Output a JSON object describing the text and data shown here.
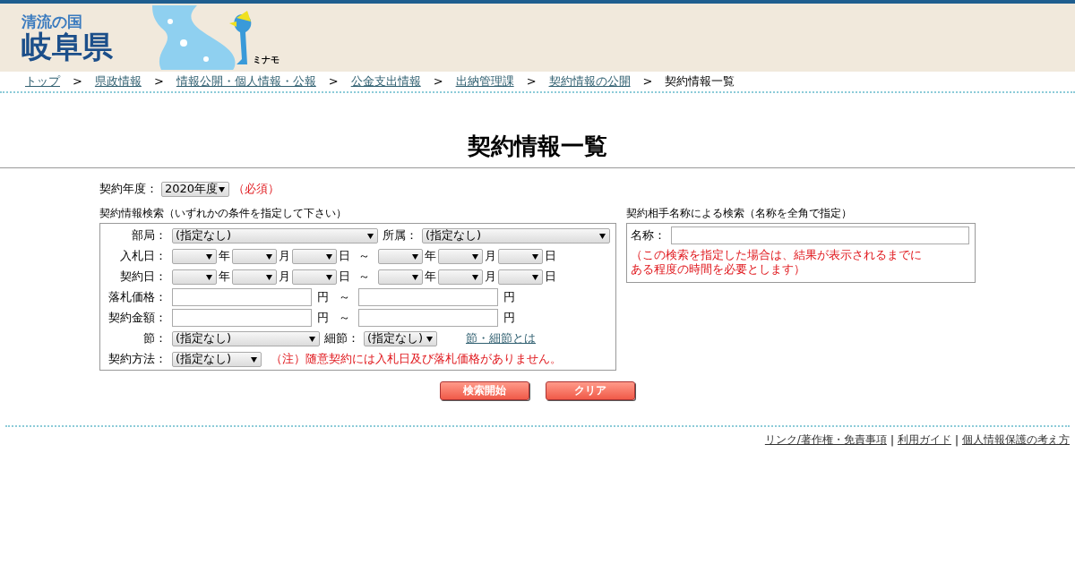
{
  "header": {
    "logo_top": "清流の国",
    "logo_main": "岐阜県",
    "mascot_label": "ミナモ"
  },
  "breadcrumb": [
    {
      "label": "トップ",
      "link": true,
      "sep": ">"
    },
    {
      "label": "県政情報",
      "link": true,
      "sep": ">"
    },
    {
      "label": "情報公開・個人情報・公報",
      "link": true,
      "sep": ">"
    },
    {
      "label": "公金支出情報",
      "link": true,
      "sep": ">"
    },
    {
      "label": "出納管理課",
      "link": true,
      "sep": ">"
    },
    {
      "label": "契約情報の公開",
      "link": true,
      "sep": ">"
    },
    {
      "label": "契約情報一覧",
      "link": false
    }
  ],
  "title": "契約情報一覧",
  "year": {
    "label": "契約年度：",
    "value": "2020年度",
    "required": "（必須）"
  },
  "criteria": {
    "legend": "契約情報検索（いずれかの条件を指定して下さい）",
    "rows": [
      {
        "kind": "pair",
        "label": "部局：",
        "value": "(指定なし)",
        "label2": "所属：",
        "value2": "(指定なし)"
      },
      {
        "kind": "date",
        "label": "入札日：",
        "units": [
          "年",
          "月",
          "日"
        ],
        "tilde": "～",
        "units2": [
          "年",
          "月",
          "日"
        ]
      },
      {
        "kind": "date",
        "label": "契約日：",
        "units": [
          "年",
          "月",
          "日"
        ],
        "tilde": "～",
        "units2": [
          "年",
          "月",
          "日"
        ]
      },
      {
        "kind": "amount",
        "label": "落札価格：",
        "unit": "円",
        "tilde": "～",
        "unit2": "円"
      },
      {
        "kind": "amount",
        "label": "契約金額：",
        "unit": "円",
        "tilde": "～",
        "unit2": "円"
      },
      {
        "kind": "section",
        "label": "節：",
        "value": "(指定なし)",
        "label2": "細節：",
        "value2": "(指定なし)",
        "link": "節・細節とは"
      },
      {
        "kind": "method",
        "label": "契約方法：",
        "value": "(指定なし)",
        "note": "（注）随意契約には入札日及び落札価格がありません。"
      }
    ]
  },
  "name_search": {
    "legend": "契約相手名称による検索（名称を全角で指定）",
    "label": "名称：",
    "note_lines": [
      "（この検索を指定した場合は、結果が表示されるまでに",
      "ある程度の時間を必要とします）"
    ]
  },
  "buttons": [
    "検索開始",
    "クリア"
  ],
  "footer_links": [
    {
      "label": "リンク/著作権・免責事項",
      "sep": "|"
    },
    {
      "label": "利用ガイド",
      "sep": "|"
    },
    {
      "label": "個人情報保護の考え方"
    }
  ]
}
